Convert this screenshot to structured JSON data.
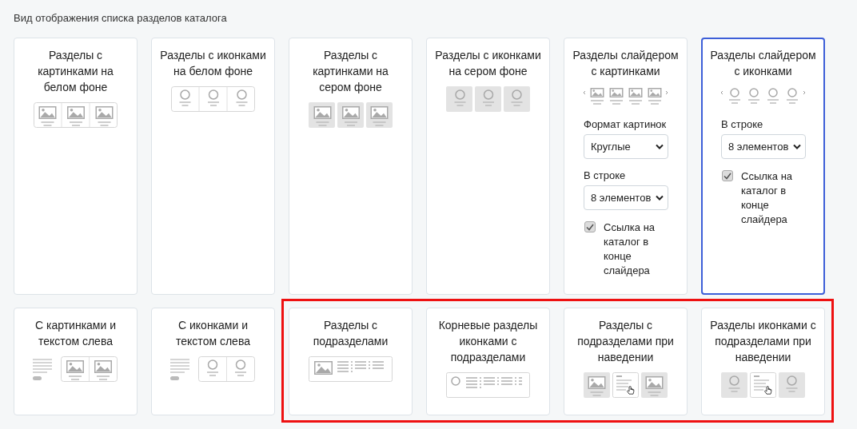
{
  "heading": "Вид отображения списка разделов каталога",
  "rows": [
    {
      "groups": [
        {
          "framed": false,
          "cards": [
            {
              "title": "Разделы с картинками на белом фоне",
              "selected": false,
              "kind": "image-tiles"
            },
            {
              "title": "Разделы с иконками на белом фоне",
              "selected": false,
              "kind": "icon-tiles"
            },
            {
              "title": "Разделы с картинками на сером фоне",
              "selected": false,
              "kind": "image-tiles-grey"
            },
            {
              "title": "Разделы с иконками на сером фоне",
              "selected": false,
              "kind": "icon-tiles-grey"
            },
            {
              "title": "Разделы слайдером с картинками",
              "selected": false,
              "kind": "image-slider",
              "controls": [
                {
                  "kind": "select",
                  "label": "Формат картинок",
                  "value": "Круглые"
                },
                {
                  "kind": "select",
                  "label": "В строке",
                  "value": "8 элементов"
                },
                {
                  "kind": "checkbox",
                  "label": "Ссылка на каталог в конце слайдера",
                  "checked": true
                }
              ]
            },
            {
              "title": "Разделы слайдером с иконками",
              "selected": true,
              "kind": "icon-slider",
              "controls": [
                {
                  "kind": "select",
                  "label": "В строке",
                  "value": "8 элементов"
                },
                {
                  "kind": "checkbox",
                  "label": "Ссылка на каталог в конце слайдера",
                  "checked": true
                }
              ]
            }
          ]
        }
      ]
    },
    {
      "groups": [
        {
          "framed": false,
          "cards": [
            {
              "title": "С картинками и текстом слева",
              "selected": false,
              "kind": "image-text-left"
            },
            {
              "title": "С иконками и текстом слева",
              "selected": false,
              "kind": "icon-text-left"
            }
          ]
        },
        {
          "framed": true,
          "cards": [
            {
              "title": "Разделы с подразделами",
              "selected": false,
              "kind": "image-subsections"
            },
            {
              "title": "Корневые разделы иконками с подразделами",
              "selected": false,
              "kind": "icon-subsections"
            },
            {
              "title": "Разделы с подразделами при наведении",
              "selected": false,
              "kind": "image-hover"
            },
            {
              "title": "Разделы иконками с подразделами при наведении",
              "selected": false,
              "kind": "icon-hover"
            }
          ]
        }
      ]
    }
  ]
}
